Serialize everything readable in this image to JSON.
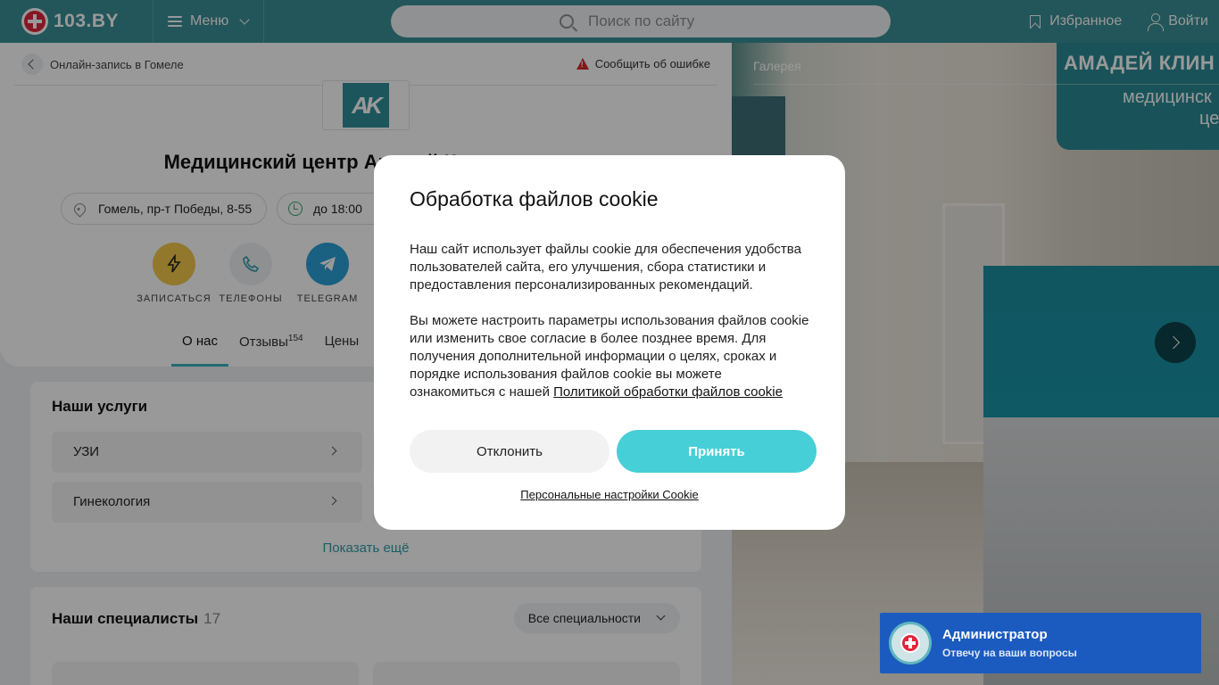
{
  "header": {
    "logo_text": "103.BY",
    "menu_label": "Меню",
    "search_placeholder": "Поиск по сайту",
    "favorites_label": "Избранное",
    "login_label": "Войти"
  },
  "breadcrumb": {
    "back_label": "Онлайн-запись в Гомеле",
    "report_label": "Сообщить об ошибке"
  },
  "clinic": {
    "logo_text": "AK",
    "title": "Медицинский центр Амадей Клиник",
    "address": "Гомель, пр-т Победы, 8-55",
    "hours": "до 18:00"
  },
  "actions": [
    {
      "label": "Записаться",
      "color": "#f2c94c",
      "icon": "flash-icon"
    },
    {
      "label": "Телефоны",
      "color": "#eef0f2",
      "icon": "phone-icon"
    },
    {
      "label": "Telegram",
      "color": "#2aa0d8",
      "icon": "telegram-icon"
    }
  ],
  "tabs": [
    {
      "label": "О нас",
      "count": ""
    },
    {
      "label": "Отзывы",
      "count": "154"
    },
    {
      "label": "Цены",
      "count": ""
    }
  ],
  "services": {
    "title": "Наши услуги",
    "items": [
      "УЗИ",
      "Гинекология"
    ],
    "show_more": "Показать ещё"
  },
  "specialists": {
    "title": "Наши специалисты",
    "count": "17",
    "filter_label": "Все специальности"
  },
  "gallery": {
    "title": "Галерея",
    "sign_line1": "АМАДЕЙ КЛИН",
    "sign_line2": "медицинск",
    "sign_line3": "цен"
  },
  "cookie_modal": {
    "title": "Обработка файлов cookie",
    "paragraph1": "Наш сайт использует файлы cookie для обеспечения удобства пользователей сайта, его улучшения, сбора статистики и предоставления персонализированных рекомендаций.",
    "paragraph2": "Вы можете настроить параметры использования файлов cookie или изменить свое согласие в более позднее время. Для получения дополнительной информации о целях, сроках и порядке использования файлов cookie вы можете ознакомиться с нашей ",
    "policy_link": "Политикой обработки файлов cookie",
    "decline_label": "Отклонить",
    "accept_label": "Принять",
    "settings_label": "Персональные настройки Cookie"
  },
  "chat": {
    "name": "Администратор",
    "subtitle": "Отвечу на ваши вопросы"
  },
  "colors": {
    "header_bg": "#3a8f96",
    "accent": "#47cfd8",
    "chat_bg": "#1b5bbf"
  }
}
